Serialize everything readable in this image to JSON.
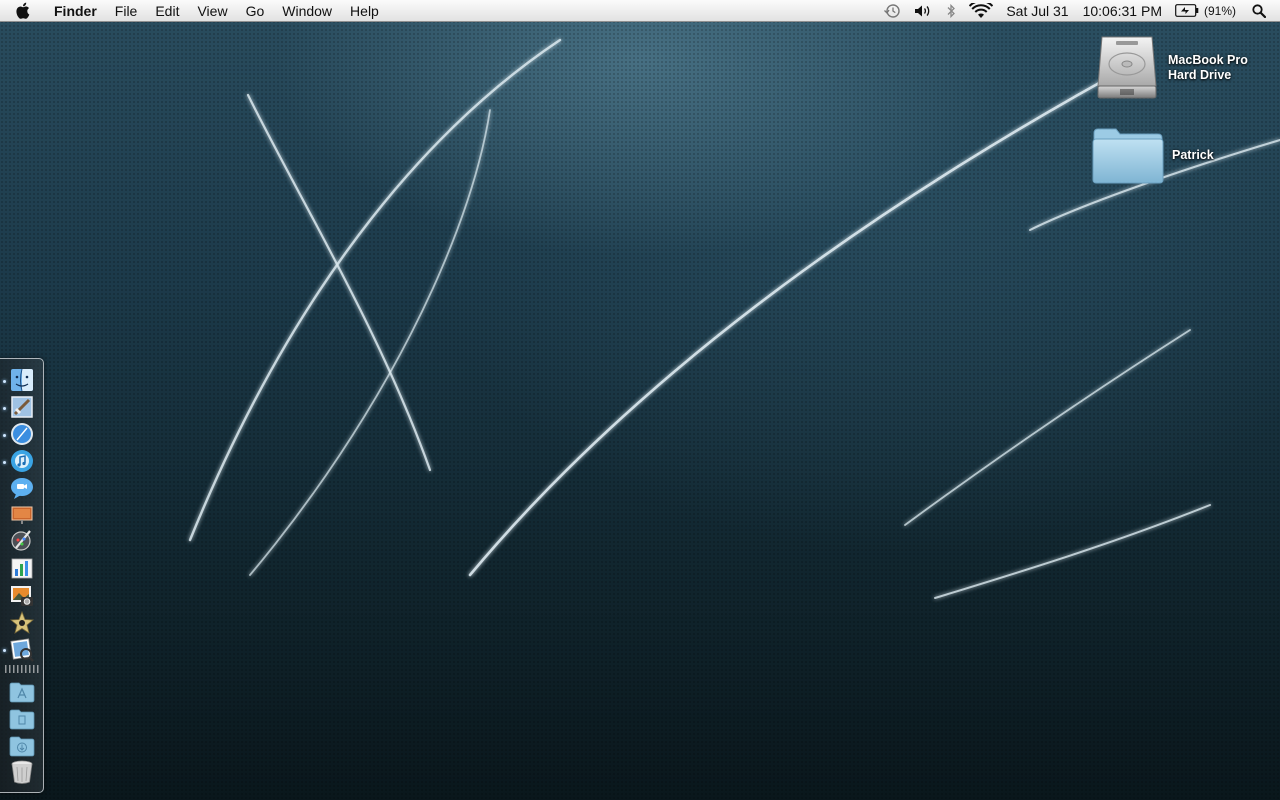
{
  "menubar": {
    "app_name": "Finder",
    "menus": [
      "File",
      "Edit",
      "View",
      "Go",
      "Window",
      "Help"
    ],
    "date": "Sat Jul 31",
    "time": "10:06:31 PM",
    "battery_percent": "(91%)"
  },
  "desktop": {
    "icons": [
      {
        "label_line1": "MacBook Pro",
        "label_line2": "Hard Drive",
        "icon": "hard-drive-icon"
      },
      {
        "label_line1": "Patrick",
        "icon": "folder-icon"
      }
    ]
  },
  "dock": {
    "apps": [
      {
        "icon": "finder-icon",
        "running": true
      },
      {
        "icon": "mail-icon",
        "running": true
      },
      {
        "icon": "safari-icon",
        "running": true
      },
      {
        "icon": "itunes-icon",
        "running": true
      },
      {
        "icon": "ichat-icon",
        "running": false
      },
      {
        "icon": "keynote-icon",
        "running": false
      },
      {
        "icon": "pixelmator-icon",
        "running": false
      },
      {
        "icon": "numbers-icon",
        "running": false
      },
      {
        "icon": "iphoto-icon",
        "running": false
      },
      {
        "icon": "imovie-icon",
        "running": false
      },
      {
        "icon": "preview-icon",
        "running": true
      }
    ],
    "stacks": [
      {
        "icon": "applications-folder-icon"
      },
      {
        "icon": "documents-folder-icon"
      },
      {
        "icon": "downloads-folder-icon"
      },
      {
        "icon": "trash-icon"
      }
    ]
  },
  "colors": {
    "dock_running_indicator": "#cfe6ff",
    "folder_blue": "#8fc4e0"
  }
}
